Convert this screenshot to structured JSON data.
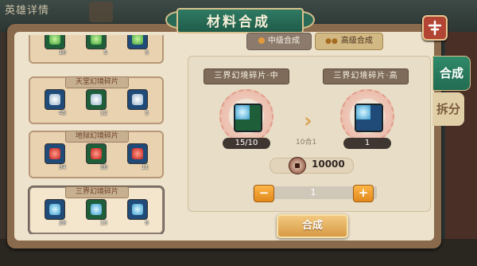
{
  "background": {
    "title": "英雄详情"
  },
  "window": {
    "title": "材料合成"
  },
  "side_tabs": [
    {
      "label": "合成",
      "active": true
    },
    {
      "label": "拆分",
      "active": false
    }
  ],
  "level_tabs": [
    {
      "label": "中级合成",
      "active": false
    },
    {
      "label": "高级合成",
      "active": true
    }
  ],
  "material_groups": [
    {
      "title": "",
      "items": [
        {
          "icon": "green-crystal-icon",
          "quality": "green",
          "count": "10"
        },
        {
          "icon": "green-crystal-icon",
          "quality": "green",
          "count": "5"
        },
        {
          "icon": "green-crystal-icon",
          "quality": "blue",
          "count": "5"
        }
      ]
    },
    {
      "title": "天堂幻境碎片",
      "items": [
        {
          "icon": "white-crystal-icon",
          "quality": "blue",
          "count": "45"
        },
        {
          "icon": "white-crystal-icon",
          "quality": "green",
          "count": "12"
        },
        {
          "icon": "white-crystal-icon",
          "quality": "blue",
          "count": "5"
        }
      ]
    },
    {
      "title": "地狱幻境碎片",
      "items": [
        {
          "icon": "red-crystal-icon",
          "quality": "blue",
          "count": "34"
        },
        {
          "icon": "red-crystal-icon",
          "quality": "green",
          "count": "30"
        },
        {
          "icon": "red-crystal-icon",
          "quality": "blue",
          "count": "11"
        }
      ]
    },
    {
      "title": "三界幻境碎片",
      "selected": true,
      "items": [
        {
          "icon": "cyan-crystal-icon",
          "quality": "blue",
          "count": "28"
        },
        {
          "icon": "cyan-crystal-icon",
          "quality": "green",
          "count": "15"
        },
        {
          "icon": "cyan-crystal-icon",
          "quality": "blue",
          "count": "0"
        }
      ]
    }
  ],
  "synthesis": {
    "source": {
      "name": "三界幻境碎片·中",
      "icon": "cyan-crystal-icon",
      "quality": "green",
      "count": "15/10"
    },
    "target": {
      "name": "三界幻境碎片·高",
      "icon": "cyan-crystal-icon",
      "quality": "blue",
      "count": "1"
    },
    "ratio": "10合1",
    "cost": "10000",
    "quantity": "1",
    "minus_label": "−",
    "plus_label": "+",
    "button_label": "合成"
  },
  "colors": {
    "accent_green": "#2f7a63",
    "button_orange": "#e0891d",
    "panel_cream": "#ede2cc"
  }
}
